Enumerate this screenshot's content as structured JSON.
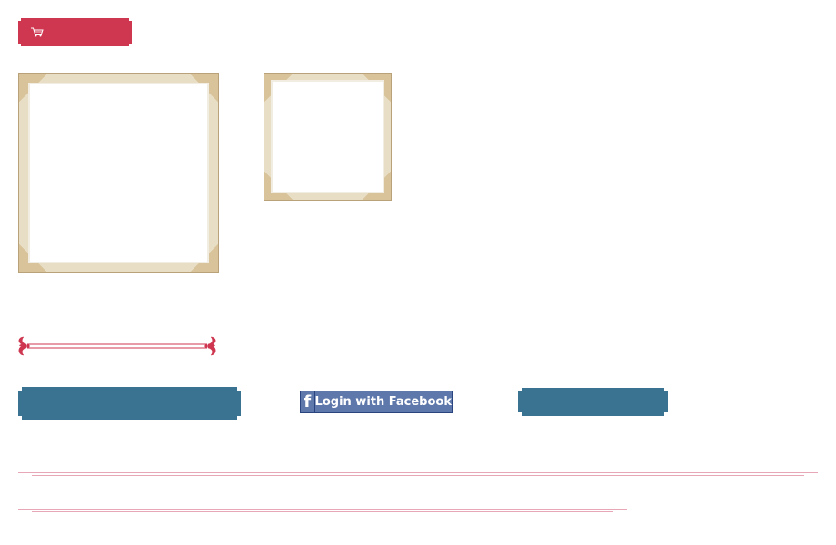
{
  "cart": {
    "label": "",
    "icon": "shopping-cart-icon",
    "color": "#cf3650"
  },
  "frames": [
    {
      "name": "large-photo-frame"
    },
    {
      "name": "small-photo-frame"
    }
  ],
  "divider": {
    "icon": "ornamental-divider-icon",
    "color": "#cf3650"
  },
  "buttons": {
    "left_bar_label": "",
    "right_bar_label": "",
    "bar_color": "#3a7292"
  },
  "facebook": {
    "icon": "facebook-f-icon",
    "icon_glyph": "f",
    "label": "Login with Facebook",
    "color": "#5f78ab"
  },
  "rules": {
    "color": "#e8a7b6"
  }
}
